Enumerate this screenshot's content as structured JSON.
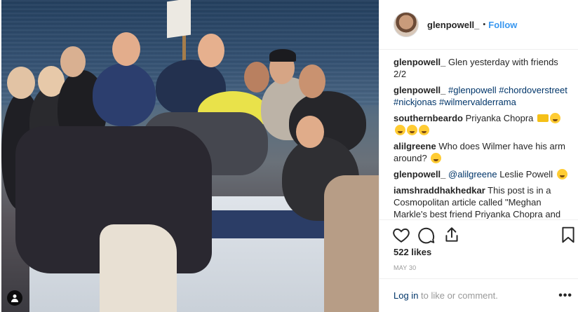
{
  "post": {
    "username": "glenpowell_",
    "follow_separator": "•",
    "follow_label": "Follow",
    "likes": "522 likes",
    "date": "MAY 30",
    "login_link": "Log in",
    "login_rest": " to like or comment.",
    "more": "•••"
  },
  "comments": [
    {
      "user": "glenpowell_",
      "text": " Glen yesterday with friends 2/2"
    },
    {
      "user": "glenpowell_",
      "text": " #glenpowell #chordoverstreet #nickjonas #wilmervalderrama"
    },
    {
      "user": "southernbeardo",
      "text": " Priyanka Chopra "
    },
    {
      "user": "alilgreene",
      "text": " Who does Wilmer have his arm around? "
    },
    {
      "user": "glenpowell_",
      "mention": " @alilgreene",
      "text": " Leslie Powell "
    },
    {
      "user": "iamshraddhakhedkar",
      "text": " This post is in a Cosmopolitan article called \"Meghan Markle's best friend Priyanka Chopra and Nick Jonas are reportedly an item\""
    }
  ],
  "icons": {
    "like": "heart-icon",
    "comment": "comment-icon",
    "share": "share-icon",
    "save": "bookmark-icon",
    "user_tag": "person-icon"
  },
  "colors": {
    "link_blue": "#3897f0",
    "hashtag": "#003569",
    "muted": "#999999"
  }
}
